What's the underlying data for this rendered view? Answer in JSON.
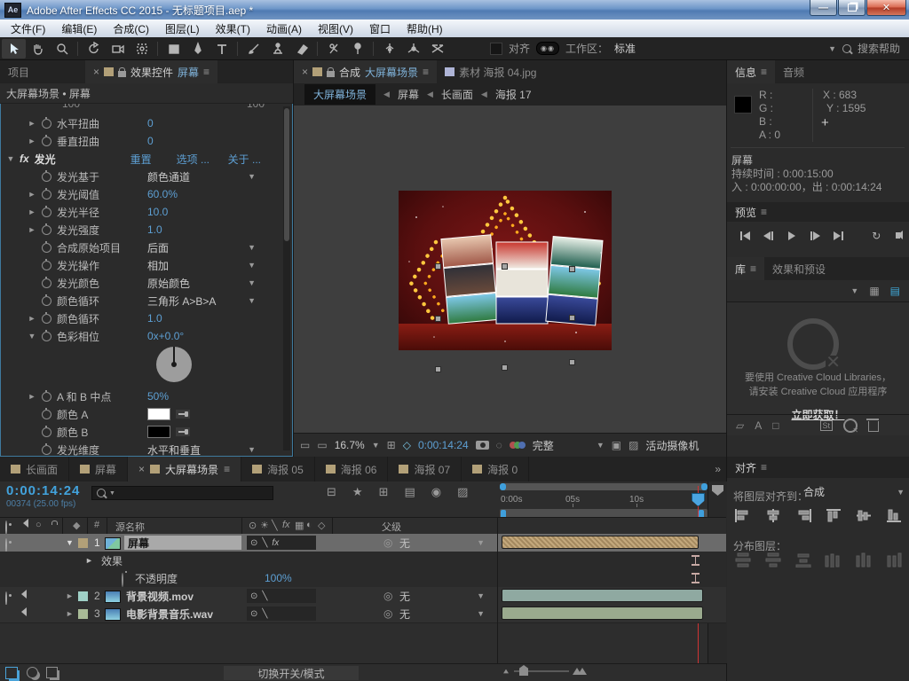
{
  "window": {
    "app_badge": "Ae",
    "title": "Adobe After Effects CC 2015 - 无标题项目.aep *"
  },
  "menubar": {
    "items": [
      "文件(F)",
      "编辑(E)",
      "合成(C)",
      "图层(L)",
      "效果(T)",
      "动画(A)",
      "视图(V)",
      "窗口",
      "帮助(H)"
    ]
  },
  "toolbar": {
    "align_label": "对齐",
    "workspace_label": "工作区：",
    "workspace_value": "标准",
    "search_placeholder": "搜索帮助"
  },
  "colors": {
    "accent_blue": "#42a2dc",
    "value_blue": "#5d9fd3",
    "playhead_red": "#cf3434",
    "label_tan": "#b2a078",
    "label_cyan": "#9fd0c6",
    "label_green": "#a9bb97",
    "bar_tan": "#c3a87c",
    "bar_teal": "#8fa9a1",
    "bar_green": "#9aaa8e"
  },
  "icons": {
    "hamburger": "≡",
    "close": "×",
    "dropdown": "▼",
    "crumb_sep": "◀",
    "expander_open": "▼",
    "expander_closed": "►",
    "overflow": "»",
    "flowchart": "⊟",
    "star": "★",
    "grid_plus": "⊞",
    "rows": "▤",
    "target": "◉",
    "shy": "⊙",
    "solar": "☀",
    "quality": "╲",
    "fx": "fx",
    "frame_blend": "▦",
    "motion_blur": "◐",
    "cube": "◇",
    "pickwhip": "◎",
    "label_diamond": "◆",
    "monitor": "▭",
    "mask": "◇",
    "ring": "◌",
    "box": "▣",
    "checker": "▨",
    "loop": "↻",
    "plus": "+",
    "hash": "#",
    "solo": "○",
    "shapes": "▱",
    "text_a": "A",
    "square": "□",
    "stock": "St"
  },
  "effects": {
    "project_tab": "项目",
    "panel_tab": "效果控件",
    "panel_layer": "屏幕",
    "breadcrumb": "大屏幕场景 • 屏幕",
    "partial_top": "100",
    "fx_group": {
      "label": "发光",
      "reset": "重置",
      "options": "选项 ...",
      "about": "关于 ..."
    },
    "rows": [
      {
        "label": "水平扭曲",
        "value": "0"
      },
      {
        "label": "垂直扭曲",
        "value": "0"
      },
      {
        "label": "发光基于",
        "value": "颜色通道"
      },
      {
        "label": "发光阈值",
        "value": "60.0%"
      },
      {
        "label": "发光半径",
        "value": "10.0"
      },
      {
        "label": "发光强度",
        "value": "1.0"
      },
      {
        "label": "合成原始项目",
        "value": "后面"
      },
      {
        "label": "发光操作",
        "value": "相加"
      },
      {
        "label": "发光颜色",
        "value": "原始颜色"
      },
      {
        "label": "颜色循环",
        "value": "三角形 A>B>A"
      },
      {
        "label": "颜色循环",
        "value": "1.0"
      },
      {
        "label": "色彩相位",
        "value": "0x+0.0°"
      },
      {
        "label": "A 和 B 中点",
        "value": "50%"
      },
      {
        "label": "颜色 A",
        "swatch": "#ffffff"
      },
      {
        "label": "颜色 B",
        "swatch": "#000000"
      },
      {
        "label": "发光维度",
        "value": "水平和垂直"
      }
    ]
  },
  "viewer": {
    "tab_kind": "合成",
    "tab_name": "大屏幕场景",
    "tab2_name": "素材 海报 04.jpg",
    "breadcrumbs": [
      "大屏幕场景",
      "屏幕",
      "长画面",
      "海报 17"
    ],
    "zoom": "16.7%",
    "time": "0:00:14:24",
    "resolution": "完整",
    "camera": "活动摄像机"
  },
  "info": {
    "tab": "信息",
    "tab2": "音频",
    "r": "R :",
    "g": "G :",
    "b": "B :",
    "a": "A : 0",
    "x": "X : 683",
    "y": "Y : 1595",
    "layer": "屏幕",
    "duration": "持续时间 : 0:00:15:00",
    "in_out": "入 : 0:00:00:00，出 : 0:00:14:24"
  },
  "preview": {
    "tab": "预览"
  },
  "library": {
    "tab": "库",
    "tab2": "效果和预设",
    "message1": "要使用 Creative Cloud Libraries，",
    "message2": "请安装 Creative Cloud 应用程序",
    "link": "立即获取！"
  },
  "align": {
    "tab": "对齐",
    "align_to_label": "将图层对齐到：",
    "align_to_value": "合成",
    "distribute_label": "分布图层："
  },
  "timeline": {
    "tabs": [
      "长画面",
      "屏幕",
      "大屏幕场景",
      "海报 05",
      "海报 06",
      "海报 07",
      "海报 0"
    ],
    "time": "0:00:14:24",
    "frames": "00374 (25.00 fps)",
    "columns": {
      "source": "源名称",
      "parent": "父级"
    },
    "ruler_ticks": [
      "0:00s",
      "05s",
      "10s"
    ],
    "layers": [
      {
        "num": "1",
        "name": "屏幕",
        "parent": "无"
      },
      {
        "num": "2",
        "name": "背景视频.mov",
        "parent": "无"
      },
      {
        "num": "3",
        "name": "电影背景音乐.wav",
        "parent": "无"
      }
    ],
    "effects_group_label": "效果",
    "opacity_label": "不透明度",
    "opacity_value": "100%",
    "toggle_button": "切换开关/模式"
  }
}
